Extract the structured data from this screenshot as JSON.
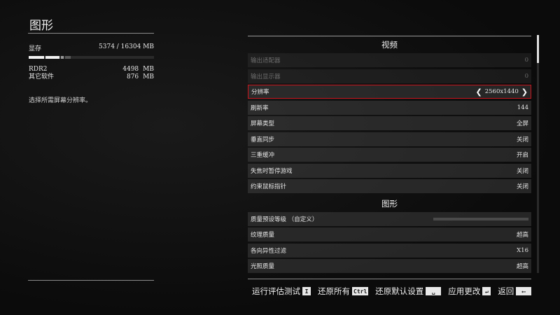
{
  "page": {
    "title": "图形"
  },
  "vram": {
    "label": "显存",
    "usage": "5374 / 16304 MB",
    "used_fraction": 0.33,
    "rows": [
      {
        "label": "RDR2",
        "value": "4498",
        "unit": "MB"
      },
      {
        "label": "其它软件",
        "value": "876",
        "unit": "MB"
      }
    ]
  },
  "description": "选择所需屏幕分辨率。",
  "sections": {
    "video": {
      "title": "视频",
      "options": [
        {
          "label": "输出适配器",
          "value": "0"
        },
        {
          "label": "输出显示器",
          "value": "0"
        },
        {
          "label": "分辨率",
          "value": "2560x1440"
        },
        {
          "label": "刷新率",
          "value": "144"
        },
        {
          "label": "屏幕类型",
          "value": "全屏"
        },
        {
          "label": "垂直同步",
          "value": "关闭"
        },
        {
          "label": "三重缓冲",
          "value": "开启"
        },
        {
          "label": "失焦时暂停游戏",
          "value": "关闭"
        },
        {
          "label": "约束鼠标指针",
          "value": "关闭"
        }
      ]
    },
    "graphics": {
      "title": "图形",
      "options": [
        {
          "label": "质量预设等级 （自定义）",
          "value": ""
        },
        {
          "label": "纹理质量",
          "value": "超高"
        },
        {
          "label": "各向异性过滤",
          "value": "X16"
        },
        {
          "label": "光照质量",
          "value": "超高"
        }
      ]
    }
  },
  "footer": {
    "run_benchmark": "运行评估测试",
    "run_benchmark_key": "I",
    "restore_all": "还原所有",
    "restore_all_key": "Ctrl",
    "restore_defaults": "还原默认设置",
    "apply_changes": "应用更改",
    "back": "返回"
  },
  "colors": {
    "selection_border": "#c8141c"
  }
}
